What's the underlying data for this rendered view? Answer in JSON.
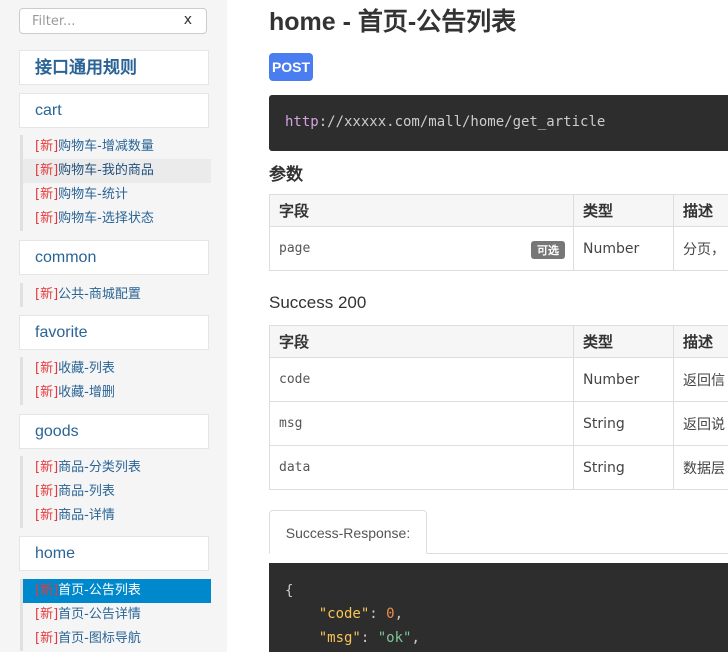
{
  "sidebar": {
    "filter_placeholder": "Filter...",
    "filter_clear": "x",
    "primary_header": "接口通用规则",
    "groups": [
      {
        "title": "cart",
        "items": [
          {
            "tag": "[新]",
            "label": "购物车-增减数量"
          },
          {
            "tag": "[新]",
            "label": "购物车-我的商品"
          },
          {
            "tag": "[新]",
            "label": "购物车-统计"
          },
          {
            "tag": "[新]",
            "label": "购物车-选择状态"
          }
        ]
      },
      {
        "title": "common",
        "items": [
          {
            "tag": "[新]",
            "label": "公共-商城配置"
          }
        ]
      },
      {
        "title": "favorite",
        "items": [
          {
            "tag": "[新]",
            "label": "收藏-列表"
          },
          {
            "tag": "[新]",
            "label": "收藏-增删"
          }
        ]
      },
      {
        "title": "goods",
        "items": [
          {
            "tag": "[新]",
            "label": "商品-分类列表"
          },
          {
            "tag": "[新]",
            "label": "商品-列表"
          },
          {
            "tag": "[新]",
            "label": "商品-详情"
          }
        ]
      },
      {
        "title": "home",
        "items": [
          {
            "tag": "[新]",
            "label": "首页-公告列表"
          },
          {
            "tag": "[新]",
            "label": "首页-公告详情"
          },
          {
            "tag": "[新]",
            "label": "首页-图标导航"
          }
        ]
      }
    ]
  },
  "main": {
    "title": "home - 首页-公告列表",
    "method": "POST",
    "url_scheme": "http",
    "url_rest": "://xxxxx.com/mall/home/get_article",
    "params_title": "参数",
    "params_table": {
      "headers": [
        "字段",
        "类型",
        "描述"
      ],
      "rows": [
        {
          "field": "page",
          "badge": "可选",
          "type": "Number",
          "desc": "分页，"
        }
      ]
    },
    "success_title": "Success 200",
    "success_table": {
      "headers": [
        "字段",
        "类型",
        "描述"
      ],
      "rows": [
        {
          "field": "code",
          "type": "Number",
          "desc": "返回信"
        },
        {
          "field": "msg",
          "type": "String",
          "desc": "返回说"
        },
        {
          "field": "data",
          "type": "String",
          "desc": "数据层"
        }
      ]
    },
    "tab_label": "Success-Response:",
    "code": {
      "open_brace": "{",
      "line1_key": "\"code\"",
      "line1_sep": ": ",
      "line1_val": "0",
      "line1_end": ",",
      "line2_key": "\"msg\"",
      "line2_sep": ": ",
      "line2_val": "\"ok\"",
      "line2_end": ","
    }
  }
}
